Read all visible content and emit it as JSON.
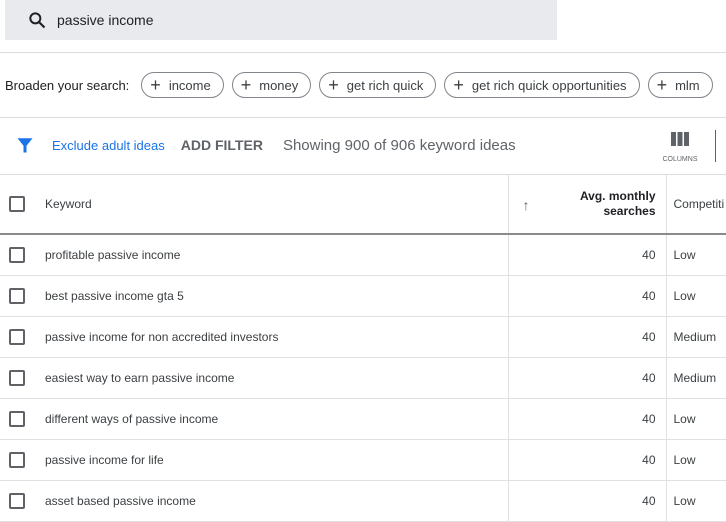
{
  "search": {
    "value": "passive income",
    "icon": "search-icon"
  },
  "broaden": {
    "label": "Broaden your search:",
    "chips": [
      "income",
      "money",
      "get rich quick",
      "get rich quick opportunities",
      "mlm"
    ]
  },
  "filterbar": {
    "exclude": "Exclude adult ideas",
    "add_filter": "ADD FILTER",
    "showing": "Showing 900 of 906 keyword ideas",
    "columns": "COLUMNS",
    "accent": "#1a73e8"
  },
  "table": {
    "headers": {
      "keyword": "Keyword",
      "avg_line1": "Avg. monthly",
      "avg_line2": "searches",
      "competition": "Competiti"
    },
    "rows": [
      {
        "keyword": "profitable passive income",
        "avg": "40",
        "competition": "Low"
      },
      {
        "keyword": "best passive income gta 5",
        "avg": "40",
        "competition": "Low"
      },
      {
        "keyword": "passive income for non accredited investors",
        "avg": "40",
        "competition": "Medium"
      },
      {
        "keyword": "easiest way to earn passive income",
        "avg": "40",
        "competition": "Medium"
      },
      {
        "keyword": "different ways of passive income",
        "avg": "40",
        "competition": "Low"
      },
      {
        "keyword": "passive income for life",
        "avg": "40",
        "competition": "Low"
      },
      {
        "keyword": "asset based passive income",
        "avg": "40",
        "competition": "Low"
      }
    ]
  }
}
